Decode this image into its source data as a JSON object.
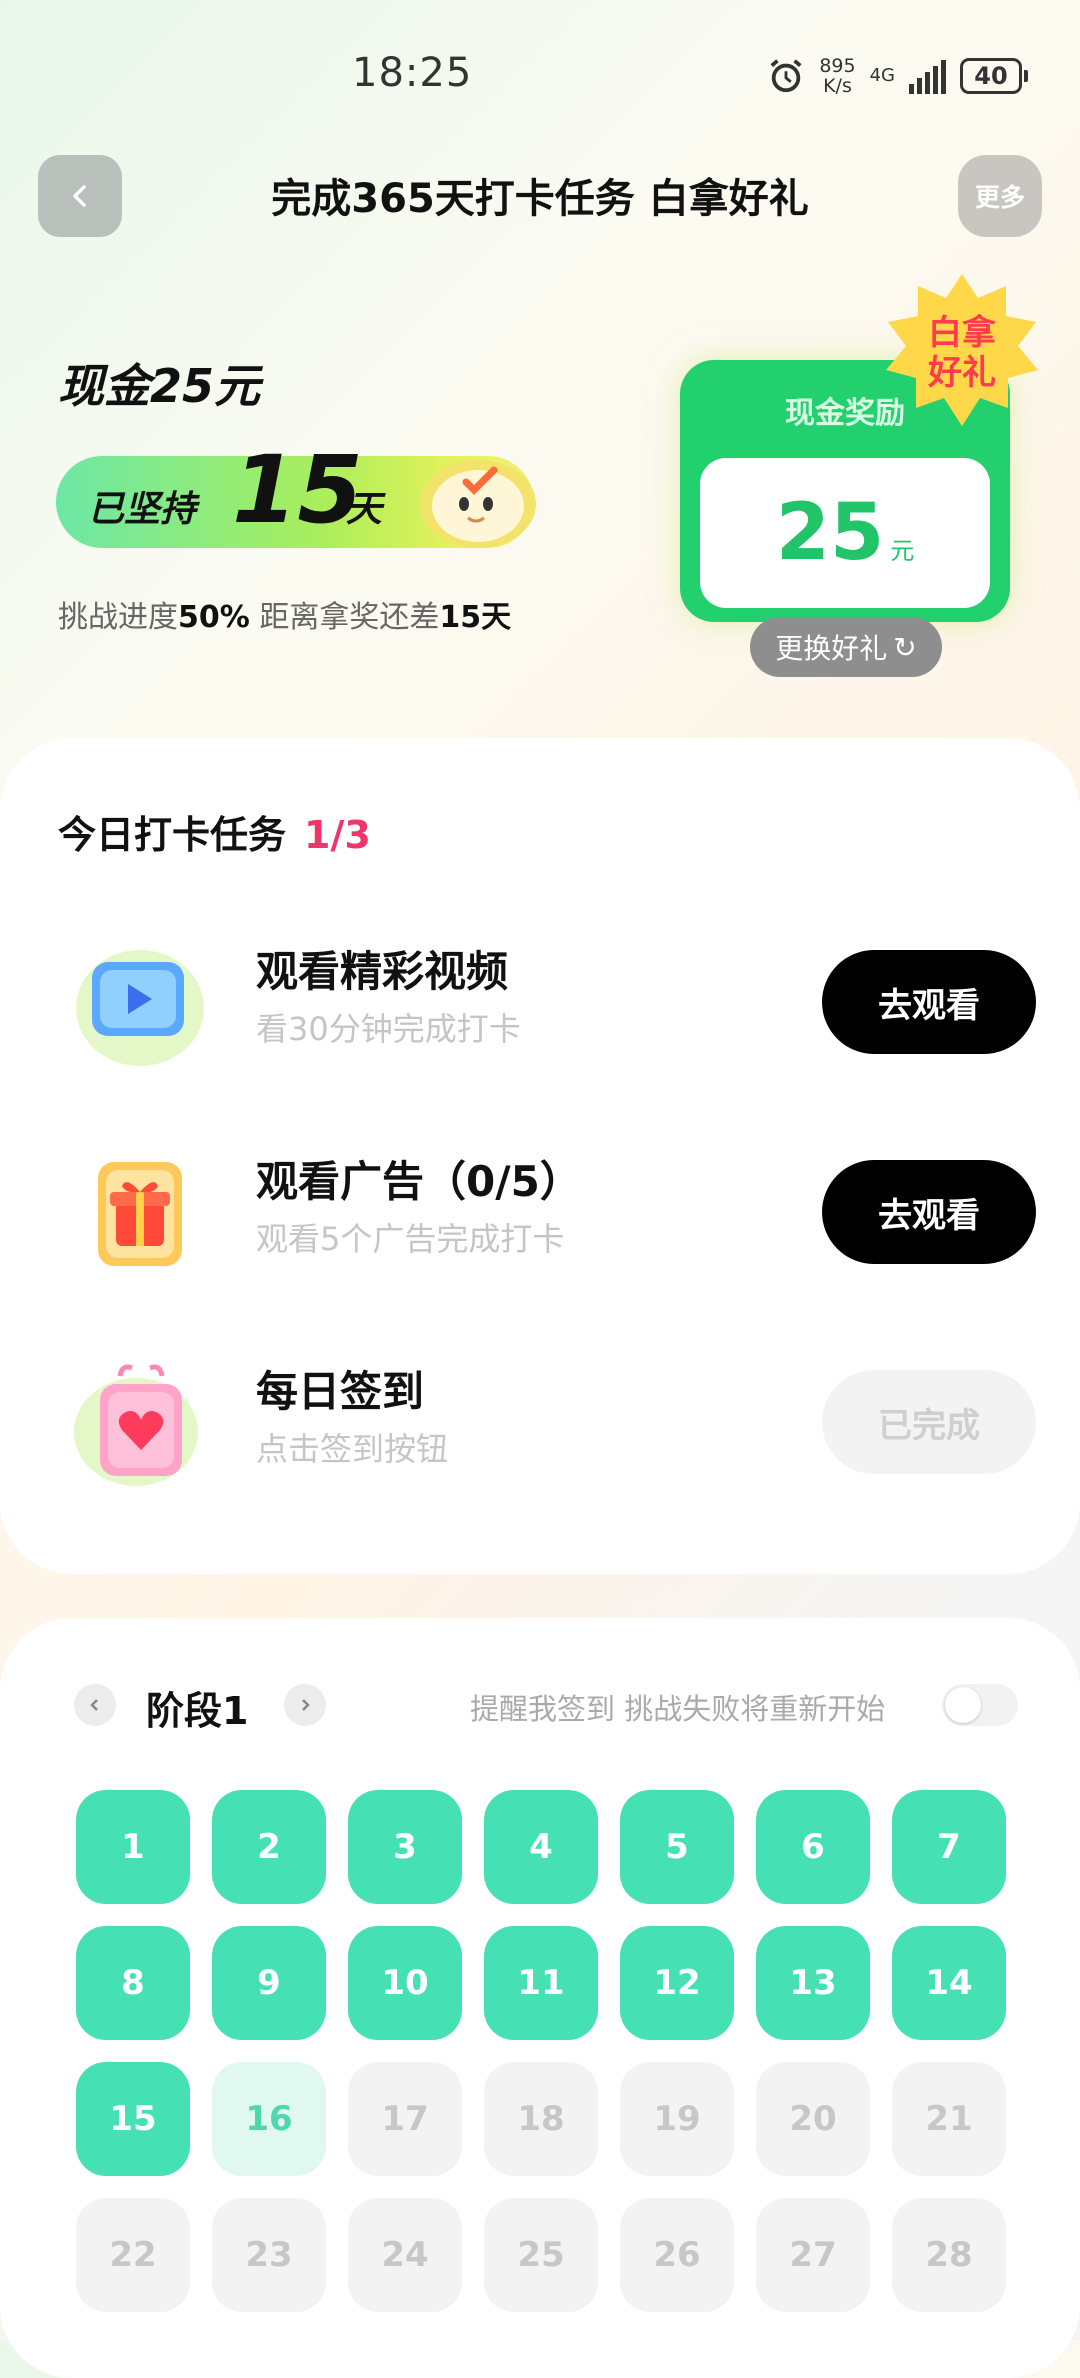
{
  "status_bar": {
    "time": "18:25",
    "net_speed": "895",
    "net_unit": "K/s",
    "network": "4G",
    "battery": "40"
  },
  "header": {
    "title": "完成365天打卡任务 白拿好礼",
    "more_label": "更多"
  },
  "challenge": {
    "reward": "现金25元",
    "streak_prefix": "已坚持",
    "streak_days": "15",
    "streak_unit": "天",
    "progress_label": "挑战进度",
    "progress_value": "50%",
    "remaining_label": " 距离拿奖还差",
    "remaining_value": "15天"
  },
  "reward_card": {
    "label": "现金奖励",
    "amount": "25",
    "unit": "元",
    "badge_line1": "白拿",
    "badge_line2": "好礼",
    "swap_label": "更换好礼",
    "card_color": "#22d06e"
  },
  "tasks": {
    "title": "今日打卡任务",
    "count": "1/3",
    "count_color": "#f0356a",
    "items": [
      {
        "title": "观看精彩视频",
        "subtitle": "看30分钟完成打卡",
        "button": "去观看",
        "icon": "video-play-icon",
        "state": "pending"
      },
      {
        "title": "观看广告（0/5）",
        "subtitle": "观看5个广告完成打卡",
        "button": "去观看",
        "icon": "gift-box-icon",
        "state": "pending"
      },
      {
        "title": "每日签到",
        "subtitle": "点击签到按钮",
        "button": "已完成",
        "icon": "heart-bag-icon",
        "state": "done"
      }
    ]
  },
  "stage": {
    "title": "阶段1",
    "reminder_label": "提醒我签到 挑战失败将重新开始",
    "reminder_on": false,
    "accent_color": "#45e0b3",
    "days": [
      {
        "n": "1",
        "state": "done"
      },
      {
        "n": "2",
        "state": "done"
      },
      {
        "n": "3",
        "state": "done"
      },
      {
        "n": "4",
        "state": "done"
      },
      {
        "n": "5",
        "state": "done"
      },
      {
        "n": "6",
        "state": "done"
      },
      {
        "n": "7",
        "state": "done"
      },
      {
        "n": "8",
        "state": "done"
      },
      {
        "n": "9",
        "state": "done"
      },
      {
        "n": "10",
        "state": "done"
      },
      {
        "n": "11",
        "state": "done"
      },
      {
        "n": "12",
        "state": "done"
      },
      {
        "n": "13",
        "state": "done"
      },
      {
        "n": "14",
        "state": "done"
      },
      {
        "n": "15",
        "state": "done"
      },
      {
        "n": "16",
        "state": "today"
      },
      {
        "n": "17",
        "state": "future"
      },
      {
        "n": "18",
        "state": "future"
      },
      {
        "n": "19",
        "state": "future"
      },
      {
        "n": "20",
        "state": "future"
      },
      {
        "n": "21",
        "state": "future"
      },
      {
        "n": "22",
        "state": "future"
      },
      {
        "n": "23",
        "state": "future"
      },
      {
        "n": "24",
        "state": "future"
      },
      {
        "n": "25",
        "state": "future"
      },
      {
        "n": "26",
        "state": "future"
      },
      {
        "n": "27",
        "state": "future"
      },
      {
        "n": "28",
        "state": "future"
      }
    ]
  }
}
